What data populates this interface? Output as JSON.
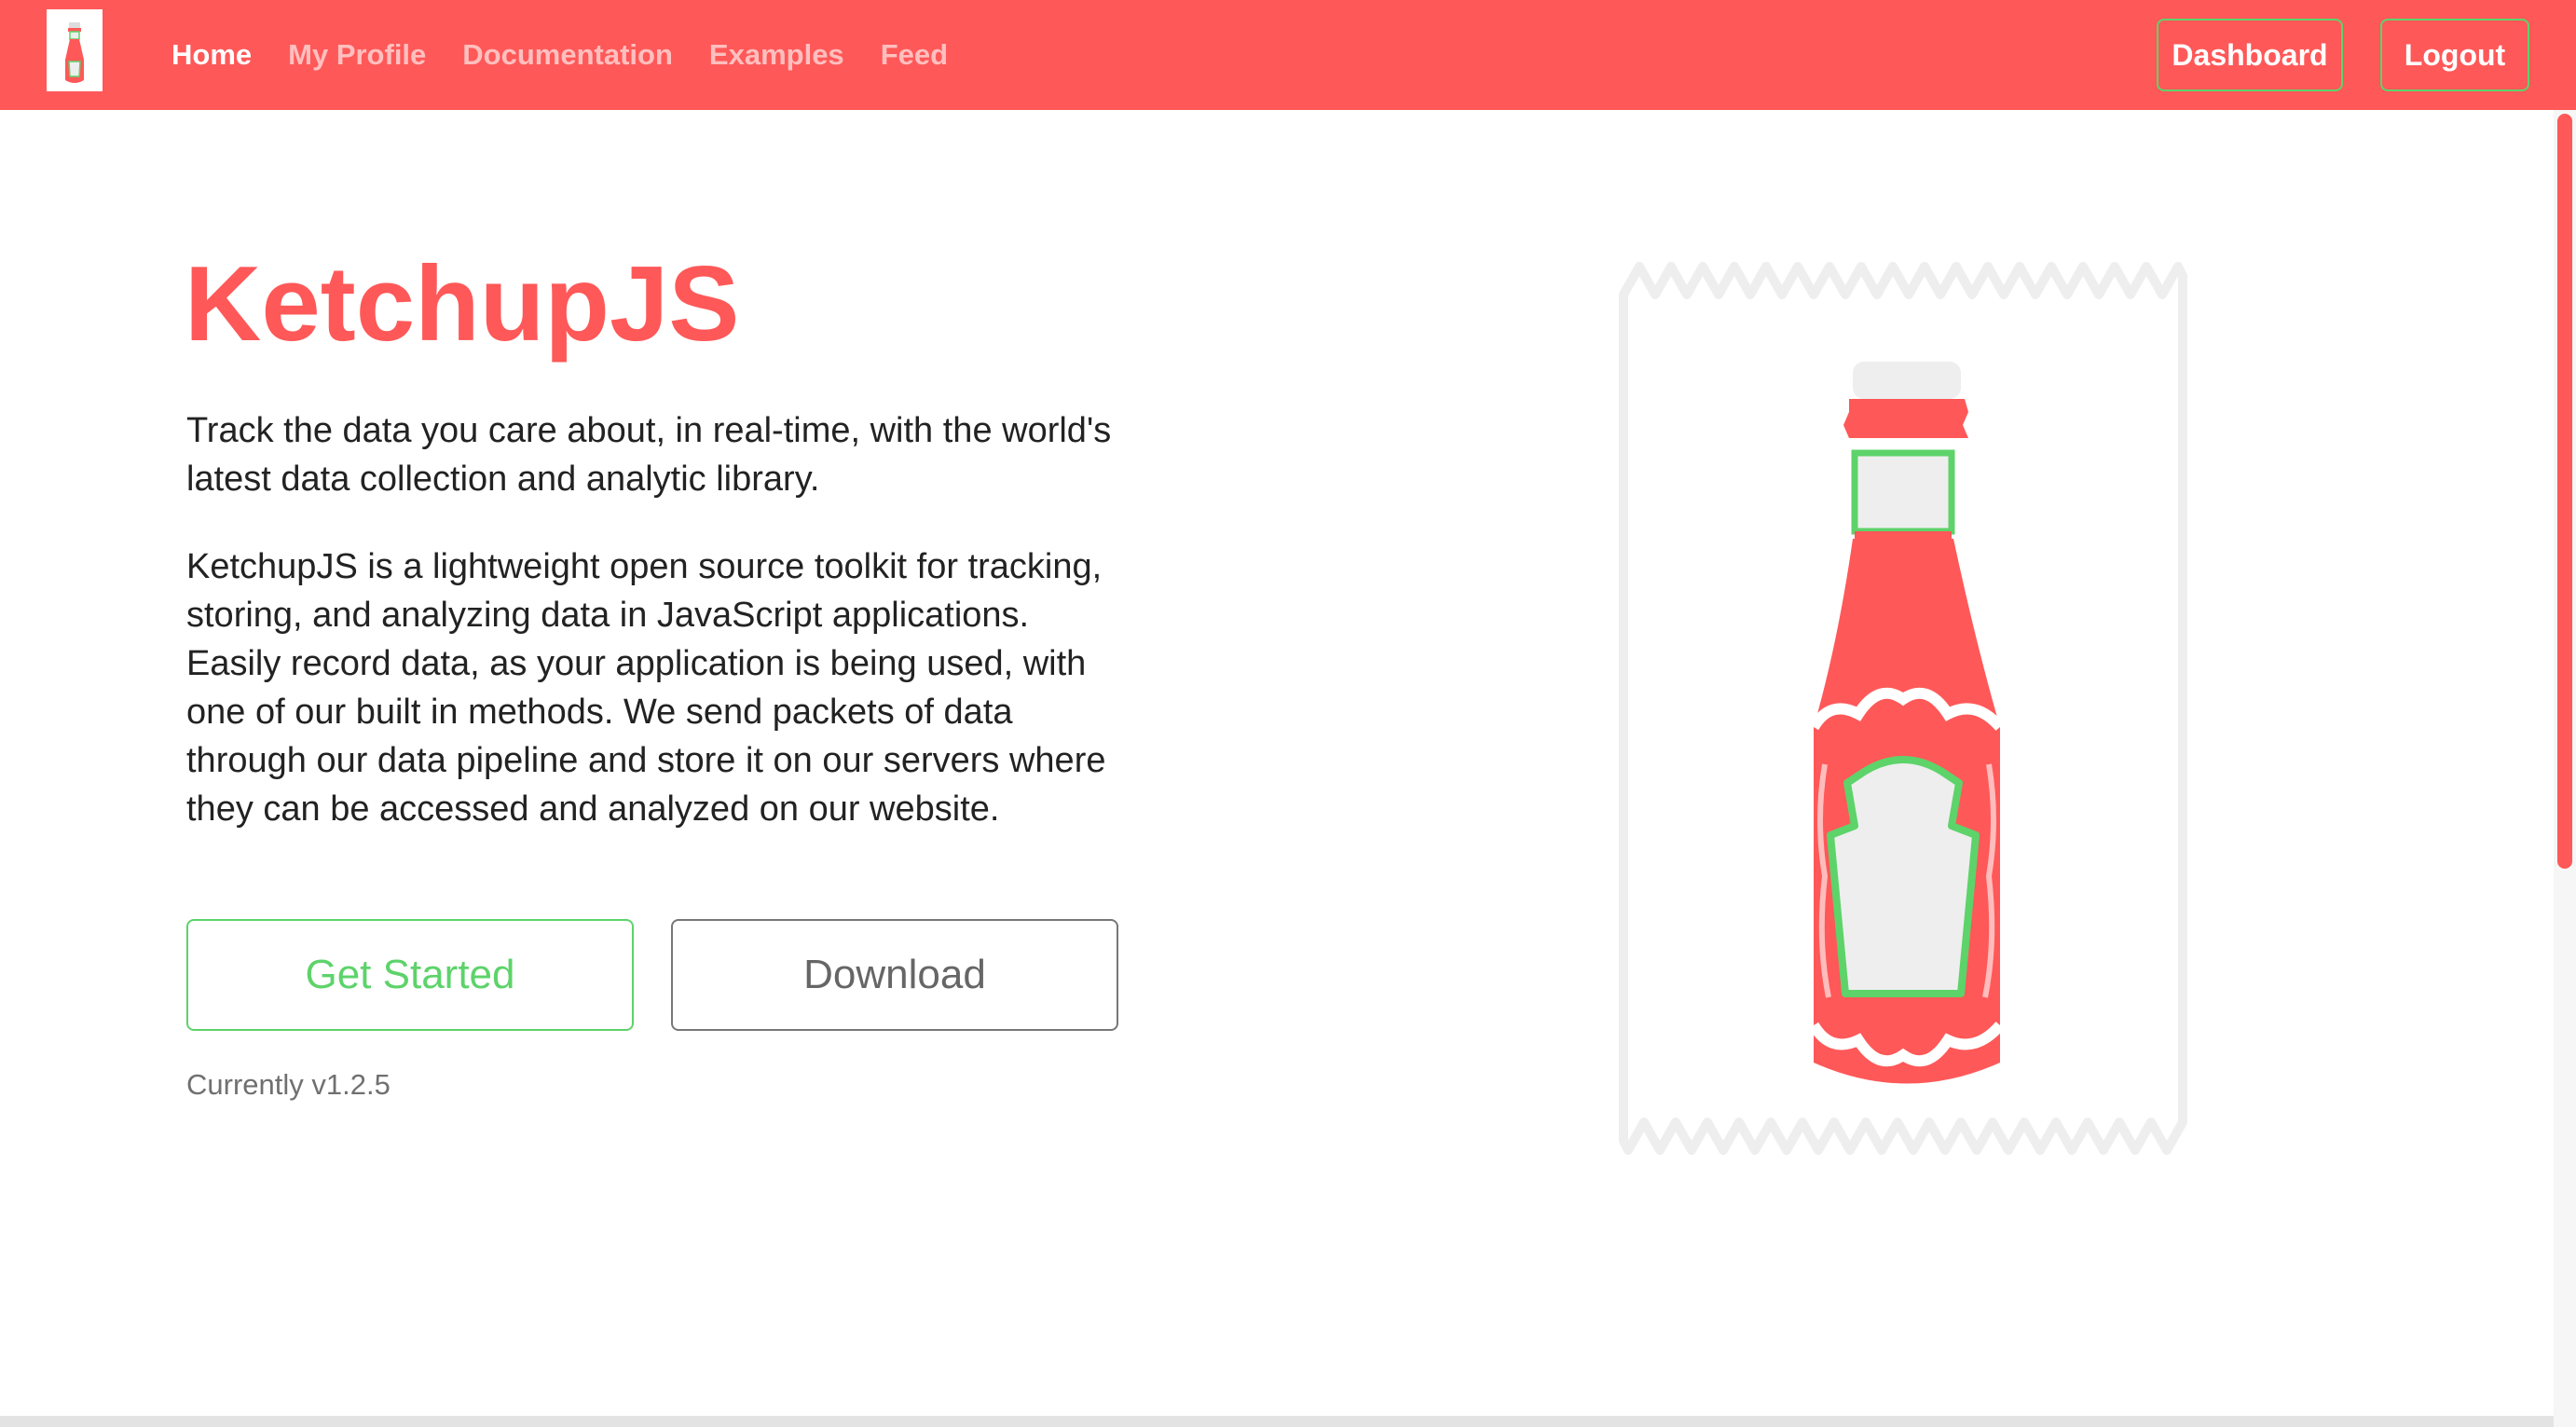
{
  "nav": {
    "links": [
      {
        "label": "Home",
        "active": true
      },
      {
        "label": "My Profile",
        "active": false
      },
      {
        "label": "Documentation",
        "active": false
      },
      {
        "label": "Examples",
        "active": false
      },
      {
        "label": "Feed",
        "active": false
      }
    ],
    "dashboard_label": "Dashboard",
    "logout_label": "Logout"
  },
  "hero": {
    "title": "KetchupJS",
    "lead": "Track the data you care about, in real-time, with the world's latest data collection and analytic library.",
    "description": "KetchupJS is a lightweight open source toolkit for tracking, storing, and analyzing data in JavaScript applications. Easily record data, as your application is being used, with one of our built in methods. We send packets of data through our data pipeline and store it on our servers where they can be accessed and analyzed on our website.",
    "get_started_label": "Get Started",
    "download_label": "Download",
    "version_text": "Currently v1.2.5"
  },
  "colors": {
    "brand_red": "#ff5858",
    "accent_green": "#5dd36a",
    "text_dark": "#222222",
    "muted_gray": "#707070",
    "packet_gray": "#eeeeee"
  },
  "icons": {
    "logo": "ketchup-bottle-icon",
    "illustration": "ketchup-packet-illustration"
  }
}
